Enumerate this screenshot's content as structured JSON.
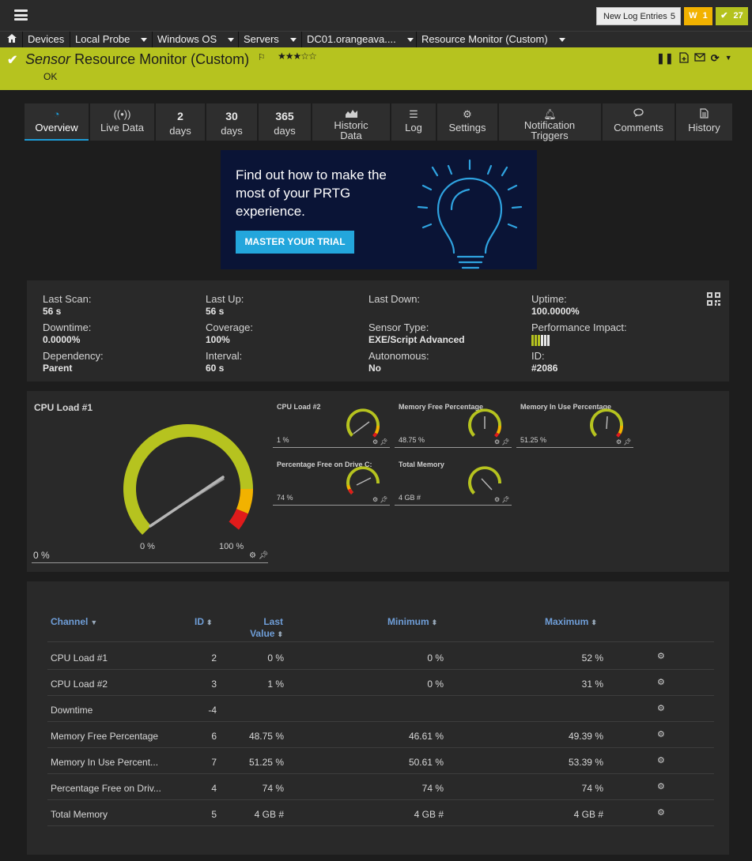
{
  "topbar": {
    "log_label": "New Log Entries",
    "log_count": "5",
    "warn_label": "W",
    "warn_count": "1",
    "ok_count": "27"
  },
  "breadcrumb": [
    "Devices",
    "Local Probe",
    "Windows OS",
    "Servers",
    "DC01.orangeava....",
    "Resource Monitor (Custom)"
  ],
  "header": {
    "prefix": "Sensor",
    "title": "Resource Monitor (Custom)",
    "status": "OK",
    "stars": "★★★☆☆"
  },
  "tabs": [
    {
      "icon": "overview-icon",
      "label": "Overview"
    },
    {
      "icon": "live-data-icon",
      "label": "Live Data"
    },
    {
      "num": "2",
      "label": "days"
    },
    {
      "num": "30",
      "label": "days"
    },
    {
      "num": "365",
      "label": "days"
    },
    {
      "icon": "historic-data-icon",
      "label": "Historic Data"
    },
    {
      "icon": "log-icon",
      "label": "Log"
    },
    {
      "icon": "settings-icon",
      "label": "Settings"
    },
    {
      "icon": "notification-icon",
      "label": "Notification Triggers"
    },
    {
      "icon": "comments-icon",
      "label": "Comments"
    },
    {
      "icon": "history-icon",
      "label": "History"
    }
  ],
  "banner": {
    "text": "Find out how to make the most of your PRTG experience.",
    "button": "MASTER YOUR TRIAL"
  },
  "info": {
    "last_scan_label": "Last Scan:",
    "last_scan": "56 s",
    "last_up_label": "Last Up:",
    "last_up": "56 s",
    "last_down_label": "Last Down:",
    "last_down": "",
    "uptime_label": "Uptime:",
    "uptime": "100.0000%",
    "downtime_label": "Downtime:",
    "downtime": "0.0000%",
    "coverage_label": "Coverage:",
    "coverage": "100%",
    "sensor_type_label": "Sensor Type:",
    "sensor_type": "EXE/Script Advanced",
    "perf_label": "Performance Impact:",
    "dependency_label": "Dependency:",
    "dependency": "Parent",
    "interval_label": "Interval:",
    "interval": "60 s",
    "autonomous_label": "Autonomous:",
    "autonomous": "No",
    "id_label": "ID:",
    "id": "#2086"
  },
  "gauges": {
    "big": {
      "title": "CPU Load #1",
      "value": "0 %",
      "min": "0 %",
      "max": "100 %"
    },
    "small": [
      {
        "title": "CPU Load #2",
        "value": "1 %"
      },
      {
        "title": "Memory Free Percentage",
        "value": "48.75 %"
      },
      {
        "title": "Memory In Use Percentage",
        "value": "51.25 %"
      },
      {
        "title": "Percentage Free on Drive C:",
        "value": "74 %"
      },
      {
        "title": "Total Memory",
        "value": "4 GB #"
      }
    ]
  },
  "table": {
    "headers": {
      "channel": "Channel",
      "id": "ID",
      "last_value_1": "Last",
      "last_value_2": "Value",
      "minimum": "Minimum",
      "maximum": "Maximum"
    },
    "rows": [
      {
        "channel": "CPU Load #1",
        "id": "2",
        "last": "0 %",
        "min": "0 %",
        "max": "52 %"
      },
      {
        "channel": "CPU Load #2",
        "id": "3",
        "last": "1 %",
        "min": "0 %",
        "max": "31 %"
      },
      {
        "channel": "Downtime",
        "id": "-4",
        "last": "",
        "min": "",
        "max": ""
      },
      {
        "channel": "Memory Free Percentage",
        "id": "6",
        "last": "48.75 %",
        "min": "46.61 %",
        "max": "49.39 %"
      },
      {
        "channel": "Memory In Use Percent...",
        "id": "7",
        "last": "51.25 %",
        "min": "50.61 %",
        "max": "53.39 %"
      },
      {
        "channel": "Percentage Free on Driv...",
        "id": "4",
        "last": "74 %",
        "min": "74 %",
        "max": "74 %"
      },
      {
        "channel": "Total Memory",
        "id": "5",
        "last": "4 GB #",
        "min": "4 GB #",
        "max": "4 GB #"
      }
    ]
  },
  "colors": {
    "accent": "#b6c31f",
    "warning": "#f2b200",
    "tab_active": "#1d9bd6",
    "link": "#6f9ed8"
  }
}
